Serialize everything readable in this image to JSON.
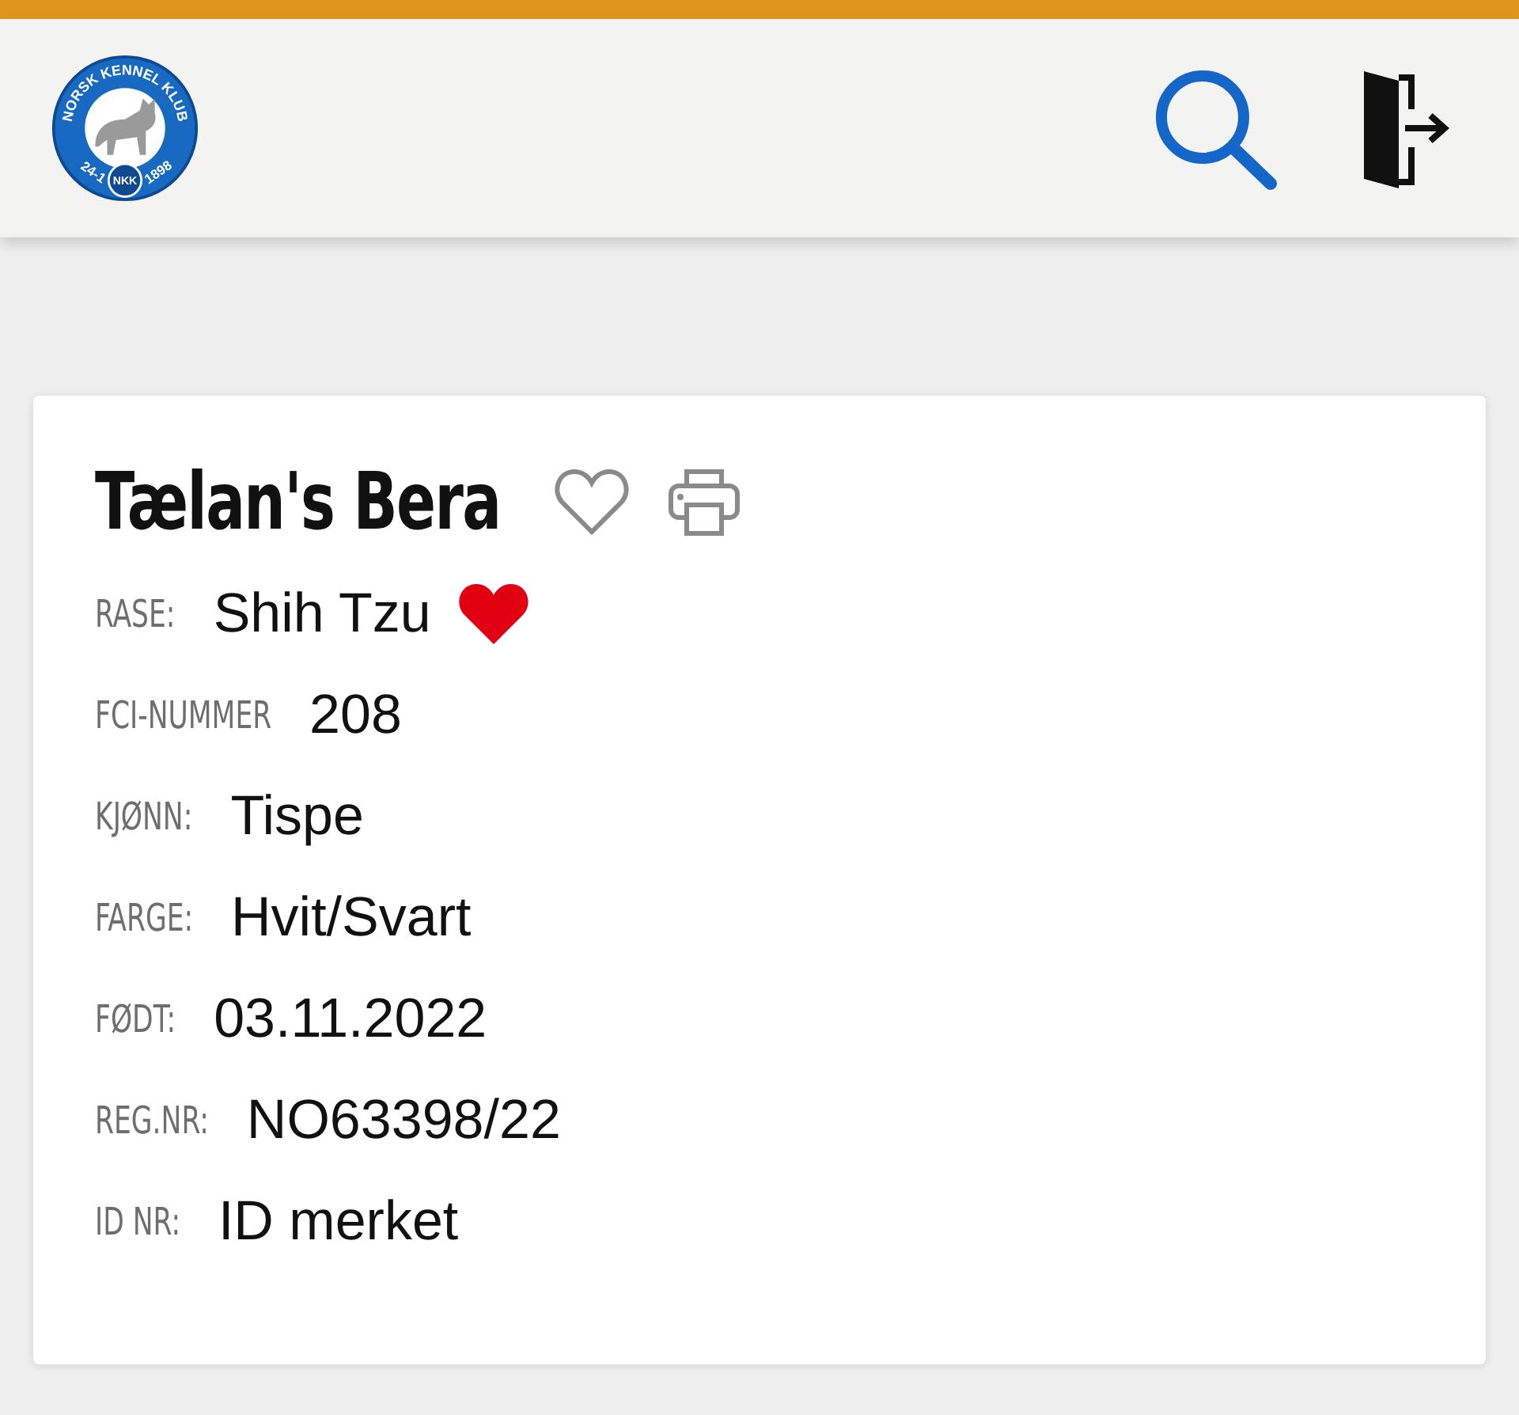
{
  "header": {
    "logo": {
      "ring_text": "NORSK KENNEL KLUB",
      "left_text": "24-1",
      "badge": "NKK",
      "right_text": "1898"
    }
  },
  "dog": {
    "name": "Tælan's Bera",
    "favorite": false,
    "fields": [
      {
        "label": "RASE:",
        "value": "Shih Tzu",
        "favorite": true
      },
      {
        "label": "FCI-NUMMER",
        "value": "208"
      },
      {
        "label": "KJØNN:",
        "value": "Tispe"
      },
      {
        "label": "FARGE:",
        "value": "Hvit/Svart"
      },
      {
        "label": "FØDT:",
        "value": "03.11.2022"
      },
      {
        "label": "REG.NR:",
        "value": "NO63398/22"
      },
      {
        "label": "ID NR:",
        "value": "ID merket"
      }
    ]
  }
}
